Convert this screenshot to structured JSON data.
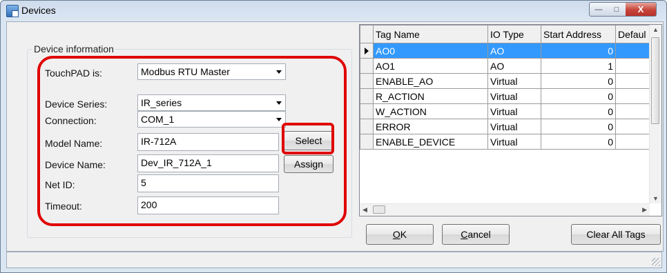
{
  "window": {
    "title": "Devices",
    "controls": {
      "minimize": "—",
      "maximize": "□",
      "close": "X"
    }
  },
  "device_info": {
    "group_title": "Device information",
    "fields": {
      "touchpad": {
        "label": "TouchPAD is:",
        "value": "Modbus RTU Master"
      },
      "series": {
        "label": "Device Series:",
        "value": "IR_series"
      },
      "connection": {
        "label": "Connection:",
        "value": "COM_1"
      },
      "model": {
        "label": "Model Name:",
        "value": "IR-712A"
      },
      "device_name": {
        "label": "Device Name:",
        "value": "Dev_IR_712A_1"
      },
      "net_id": {
        "label": "Net ID:",
        "value": "5"
      },
      "timeout": {
        "label": "Timeout:",
        "value": "200"
      }
    },
    "select_label": "Select",
    "assign_label": "Assign",
    "highlight_color": "#e00000"
  },
  "tags_grid": {
    "columns": [
      "Tag Name",
      "IO Type",
      "Start Address",
      "Defaul"
    ],
    "rows": [
      {
        "name": "AO0",
        "type": "AO",
        "addr": "0",
        "def": ""
      },
      {
        "name": "AO1",
        "type": "AO",
        "addr": "1",
        "def": ""
      },
      {
        "name": "ENABLE_AO",
        "type": "Virtual",
        "addr": "0",
        "def": ""
      },
      {
        "name": "R_ACTION",
        "type": "Virtual",
        "addr": "0",
        "def": ""
      },
      {
        "name": "W_ACTION",
        "type": "Virtual",
        "addr": "0",
        "def": ""
      },
      {
        "name": "ERROR",
        "type": "Virtual",
        "addr": "0",
        "def": ""
      },
      {
        "name": "ENABLE_DEVICE",
        "type": "Virtual",
        "addr": "0",
        "def": ""
      }
    ],
    "selected_row": 0,
    "selection_color": "#3399ff"
  },
  "buttons": {
    "ok": "OK",
    "cancel": "Cancel",
    "clear_all": "Clear All Tags"
  }
}
